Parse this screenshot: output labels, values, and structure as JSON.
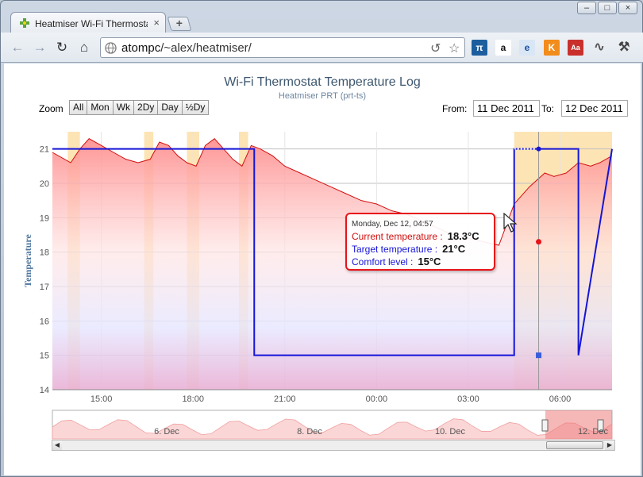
{
  "browser": {
    "tab_title": "Heatmiser Wi-Fi Thermostat",
    "tab_close": "×",
    "newtab": "+",
    "url_host": "atompc",
    "url_path": "/~alex/heatmiser/",
    "window_controls": [
      "–",
      "□",
      "×"
    ]
  },
  "page": {
    "title": "Wi-Fi Thermostat Temperature Log",
    "subtitle": "Heatmiser PRT (prt-ts)",
    "zoom_label": "Zoom",
    "zoom_buttons": [
      "All",
      "Mon",
      "Wk",
      "2Dy",
      "Day",
      "½Dy"
    ],
    "from_label": "From:",
    "from_value": "11 Dec 2011",
    "to_label": "To:",
    "to_value": "12 Dec 2011"
  },
  "tooltip": {
    "header": "Monday, Dec 12, 04:57",
    "current_label": "Current temperature :",
    "current_value": "18.3°C",
    "target_label": "Target temperature :",
    "target_value": "21°C",
    "comfort_label": "Comfort level :",
    "comfort_value": "15°C"
  },
  "colors": {
    "current": "#d01010",
    "target": "#1515d8",
    "comfort": "#1515d8",
    "band": "#fde3b0"
  },
  "chart_data": {
    "type": "area",
    "title": "Wi-Fi Thermostat Temperature Log",
    "subtitle": "Heatmiser PRT (prt-ts)",
    "ylabel": "Temperature",
    "ylim": [
      14,
      21.5
    ],
    "yticks": [
      14,
      15,
      16,
      17,
      18,
      19,
      20,
      21
    ],
    "xticks": [
      "15:00",
      "18:00",
      "21:00",
      "00:00",
      "03:00",
      "06:00"
    ],
    "xlim_hours": [
      13.4,
      31.7
    ],
    "series": [
      {
        "name": "Current temperature",
        "x_hours": [
          13.4,
          13.8,
          14.0,
          14.3,
          14.6,
          15.0,
          15.4,
          15.8,
          16.2,
          16.6,
          16.9,
          17.2,
          17.5,
          17.8,
          18.1,
          18.4,
          18.7,
          19.0,
          19.3,
          19.6,
          19.9,
          20.2,
          20.6,
          21.0,
          21.5,
          22.0,
          22.5,
          23.0,
          23.5,
          24.0,
          24.5,
          25.0,
          25.5,
          26.0,
          26.5,
          27.0,
          27.5,
          28.0,
          28.5,
          29.0,
          29.5,
          29.8,
          30.2,
          30.6,
          31.0,
          31.3,
          31.7
        ],
        "y": [
          20.9,
          20.7,
          20.6,
          21.0,
          21.3,
          21.1,
          20.9,
          20.7,
          20.6,
          20.7,
          21.2,
          21.1,
          20.8,
          20.6,
          20.5,
          21.1,
          21.3,
          21.0,
          20.7,
          20.5,
          21.1,
          21.0,
          20.8,
          20.5,
          20.3,
          20.1,
          19.9,
          19.7,
          19.5,
          19.4,
          19.2,
          19.1,
          18.9,
          18.7,
          18.5,
          18.4,
          18.3,
          18.2,
          19.4,
          19.9,
          20.3,
          20.2,
          20.3,
          20.6,
          20.5,
          20.6,
          20.8
        ]
      },
      {
        "name": "Target temperature",
        "x_hours": [
          13.4,
          20.0,
          20.0,
          28.5,
          28.5,
          30.6,
          30.6,
          31.7
        ],
        "y": [
          21,
          21,
          15,
          15,
          21,
          21,
          15,
          21
        ]
      },
      {
        "name": "Comfort level",
        "x_hours": [
          13.4,
          31.7
        ],
        "y": [
          15,
          15
        ]
      }
    ],
    "highlight_bands_hours": [
      [
        13.9,
        14.3
      ],
      [
        16.4,
        16.7
      ],
      [
        17.8,
        18.2
      ],
      [
        19.5,
        19.8
      ],
      [
        28.5,
        31.7
      ]
    ],
    "navigator_labels": [
      "6. Dec",
      "8. Dec",
      "10. Dec",
      "12. Dec"
    ]
  }
}
